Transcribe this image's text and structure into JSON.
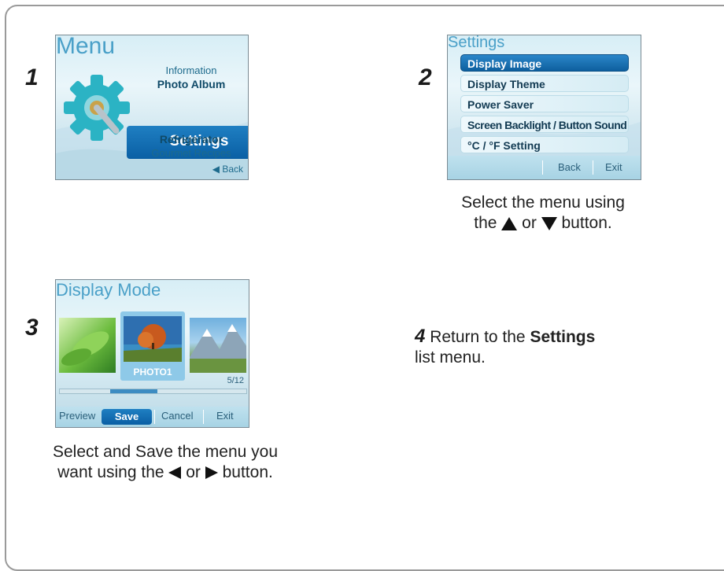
{
  "steps": {
    "s1": {
      "number": "1",
      "screen_title": "Menu",
      "items": [
        "Information",
        "Photo Album",
        "Settings",
        "Refrigerator",
        "Gourmet Recipes"
      ],
      "back": "◀ Back"
    },
    "s2": {
      "number": "2",
      "screen_title": "Settings",
      "items": [
        "Display Image",
        "Display Theme",
        "Power Saver",
        "Screen Backlight / Button Sound",
        "°C / °F Setting"
      ],
      "footer": {
        "back": "Back",
        "exit": "Exit"
      },
      "caption_line1": "Select the menu using",
      "caption_pre": "the ",
      "caption_mid": " or ",
      "caption_post": "button."
    },
    "s3": {
      "number": "3",
      "screen_title": "Display Mode",
      "photo_label": "PHOTO1",
      "counter": "5/12",
      "footer": {
        "preview": "Preview",
        "save": "Save",
        "cancel": "Cancel",
        "exit": "Exit"
      },
      "caption_line1": "Select and Save the menu you",
      "caption_pre": "want using the ",
      "caption_mid": " or ",
      "caption_post": " button."
    },
    "s4": {
      "number": "4",
      "text_pre": "Return to the ",
      "text_bold": "Settings",
      "text_post": "list menu."
    }
  },
  "icons": [
    "gear-wrench-icon",
    "up-triangle-icon",
    "down-triangle-icon",
    "left-triangle-icon",
    "right-triangle-icon"
  ],
  "colors": {
    "accent": "#0a5fa4",
    "title": "#4aa0c8",
    "screen_bg": "#d7eef6"
  }
}
